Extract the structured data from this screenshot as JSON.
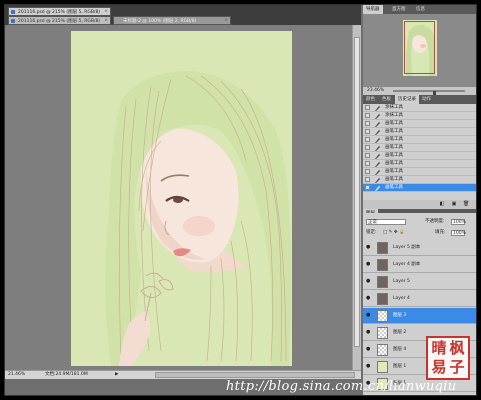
{
  "documents": {
    "tabs": [
      {
        "label": "201116.psd @ 215% (图层 5, RGB/8)"
      },
      {
        "label": "201116.psd @ 215% (图层 5, RGB/8)"
      },
      {
        "label": "未标题-2 @ 100% (图层 2, RGB/8)"
      }
    ]
  },
  "status": {
    "zoom": "21.46%",
    "doc_size": "文档:24.9M/181.0M",
    "arrow": "▶"
  },
  "panels": {
    "top_tabs": [
      "导航器",
      "直方图",
      "信息"
    ],
    "nav_zoom": "23.46%",
    "history_tabs": [
      "颜色",
      "色板",
      "历史记录",
      "动作"
    ],
    "history_items": [
      {
        "label": "涂抹工具"
      },
      {
        "label": "涂抹工具"
      },
      {
        "label": "画笔工具"
      },
      {
        "label": "画笔工具"
      },
      {
        "label": "画笔工具"
      },
      {
        "label": "画笔工具"
      },
      {
        "label": "画笔工具"
      },
      {
        "label": "画笔工具"
      },
      {
        "label": "画笔工具"
      },
      {
        "label": "画笔工具"
      },
      {
        "label": "画笔工具"
      }
    ],
    "history_selected_index": 10,
    "layers_tab": "图层",
    "blend_mode": "正常",
    "opacity_label": "不透明度:",
    "opacity_value": "100%",
    "lock_label": "锁定:",
    "fill_label": "填充:",
    "fill_value": "100%",
    "layers": [
      {
        "name": "Layer 5 副本",
        "thumb": "#6e6460"
      },
      {
        "name": "Layer 4 副本",
        "thumb": "#6e6460"
      },
      {
        "name": "Layer 5",
        "thumb": "#6e6460"
      },
      {
        "name": "Layer 4",
        "thumb": "#6e6460"
      },
      {
        "name": "图层 3",
        "thumb": "checker"
      },
      {
        "name": "图层 2",
        "thumb": "checker"
      },
      {
        "name": "图层 4",
        "thumb": "checker"
      },
      {
        "name": "图层 1",
        "thumb": "#dfeab9"
      },
      {
        "name": "图层 1",
        "thumb": "#dfeab9"
      }
    ],
    "layers_selected_index": 4
  },
  "seal": [
    "晴",
    "枫",
    "易",
    "子"
  ],
  "watermark": "http://blog.sina.com.cn/lianwuqiu",
  "colors": {
    "canvas_bg": "#d8e7b3",
    "selection": "#3b8ae6",
    "seal_red": "#c8342c"
  }
}
